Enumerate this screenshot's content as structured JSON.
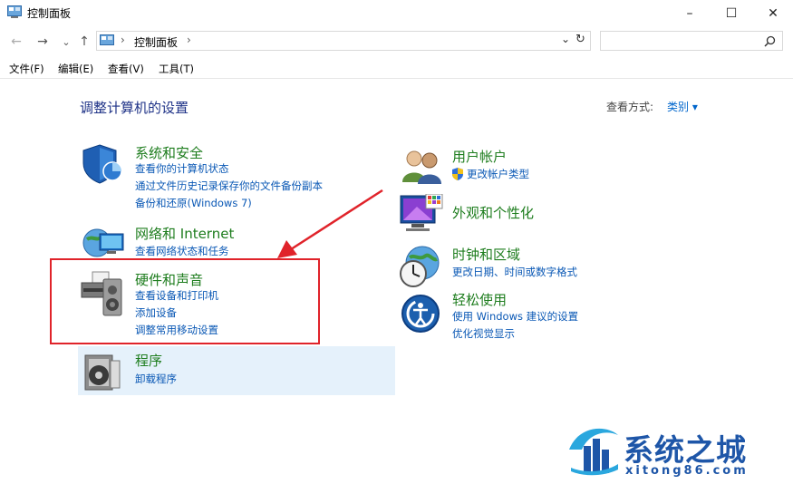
{
  "window": {
    "title": "控制面板",
    "minimize": "–",
    "maximize": "☐",
    "close": "✕"
  },
  "nav": {
    "back": "←",
    "forward": "→",
    "recent": "⌄",
    "up": "↑"
  },
  "address": {
    "separator": "›",
    "path": "控制面板",
    "dropdown": "⌄",
    "refresh": "↻"
  },
  "search": {
    "placeholder": ""
  },
  "menu": [
    "文件(F)",
    "编辑(E)",
    "查看(V)",
    "工具(T)"
  ],
  "main": {
    "heading": "调整计算机的设置",
    "view_by_label": "查看方式:",
    "view_by_value": "类别 ▾"
  },
  "categories_left": [
    {
      "title": "系统和安全",
      "links": [
        "查看你的计算机状态",
        "通过文件历史记录保存你的文件备份副本",
        "备份和还原(Windows 7)"
      ]
    },
    {
      "title": "网络和 Internet",
      "links": [
        "查看网络状态和任务"
      ]
    },
    {
      "title": "硬件和声音",
      "links": [
        "查看设备和打印机",
        "添加设备",
        "调整常用移动设置"
      ]
    },
    {
      "title": "程序",
      "links": [
        "卸载程序"
      ]
    }
  ],
  "categories_right": [
    {
      "title": "用户帐户",
      "links": [
        "更改帐户类型"
      ]
    },
    {
      "title": "外观和个性化",
      "links": []
    },
    {
      "title": "时钟和区域",
      "links": [
        "更改日期、时间或数字格式"
      ]
    },
    {
      "title": "轻松使用",
      "links": [
        "使用 Windows 建议的设置",
        "优化视觉显示"
      ]
    }
  ],
  "watermark": {
    "text": "系统之城",
    "url": "xitong86.com"
  },
  "colors": {
    "category_title": "#1e7d1e",
    "link": "#0a58b5",
    "heading": "#1e3287",
    "annotation": "#e0232a",
    "highlight": "#e5f1fb"
  }
}
